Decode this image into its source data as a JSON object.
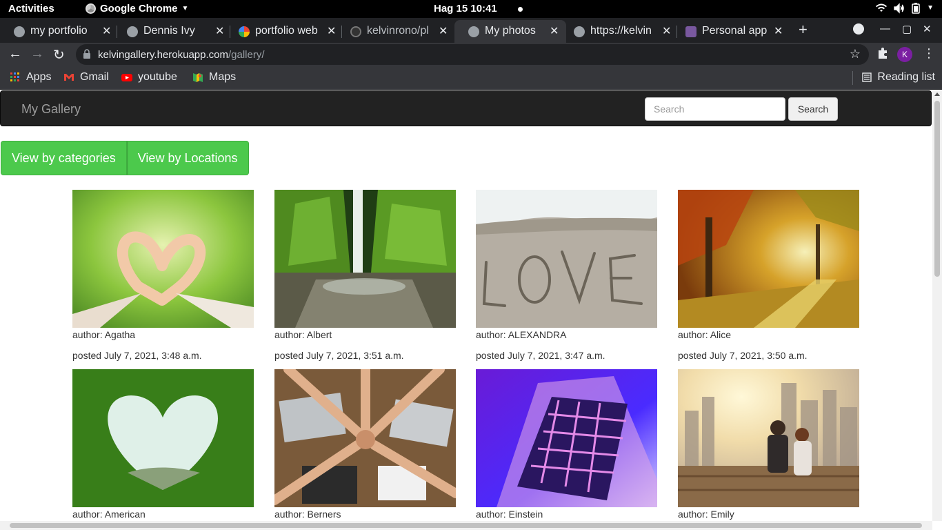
{
  "system": {
    "activities": "Activities",
    "app_name": "Google Chrome",
    "clock": "Hag 15  10:41"
  },
  "tabs": [
    {
      "title": "my portfolio",
      "active": false
    },
    {
      "title": "Dennis Ivy",
      "active": false
    },
    {
      "title": "portfolio web",
      "active": false
    },
    {
      "title": "kelvinrono/pl",
      "active": false
    },
    {
      "title": "My photos",
      "active": true
    },
    {
      "title": "https://kelvin",
      "active": false
    },
    {
      "title": "Personal app",
      "active": false
    }
  ],
  "toolbar": {
    "url_host": "kelvingallery.herokuapp.com",
    "url_path": "/gallery/",
    "profile_initial": "K"
  },
  "bookmarks": {
    "items": [
      "Apps",
      "Gmail",
      "youtube",
      "Maps"
    ],
    "reading_list": "Reading list"
  },
  "page": {
    "brand": "My Gallery",
    "search_placeholder": "Search",
    "search_button": "Search",
    "buttons": {
      "categories": "View by categories",
      "locations": "View by Locations"
    },
    "photos": [
      {
        "author": "author: Agatha",
        "posted": "posted July 7, 2021, 3:48 a.m."
      },
      {
        "author": "author: Albert",
        "posted": "posted July 7, 2021, 3:51 a.m."
      },
      {
        "author": "author: ALEXANDRA",
        "posted": "posted July 7, 2021, 3:47 a.m."
      },
      {
        "author": "author: Alice",
        "posted": "posted July 7, 2021, 3:50 a.m."
      },
      {
        "author": "author: American",
        "posted": ""
      },
      {
        "author": "author: Berners",
        "posted": ""
      },
      {
        "author": "author: Einstein",
        "posted": ""
      },
      {
        "author": "author: Emily",
        "posted": ""
      }
    ]
  }
}
